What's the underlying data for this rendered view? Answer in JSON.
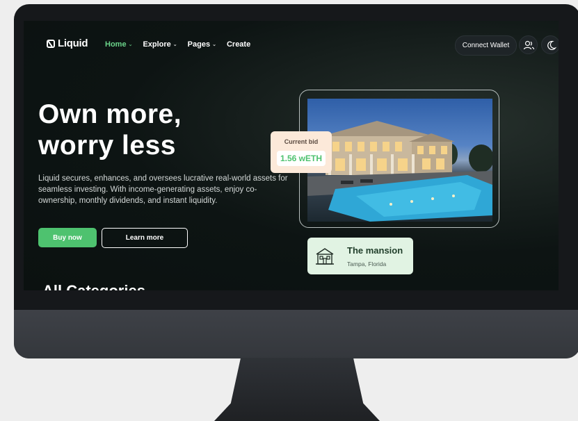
{
  "nav": {
    "logo": "Liquid",
    "menu": [
      {
        "label": "Home",
        "active": true
      },
      {
        "label": "Explore"
      },
      {
        "label": "Pages"
      },
      {
        "label": "Create"
      }
    ],
    "connect_wallet": "Connect Wallet",
    "icons": [
      "users-icon",
      "moon-icon"
    ]
  },
  "hero": {
    "title_line1": "Own more,",
    "title_line2": "worry less",
    "description": "Liquid secures, enhances, and oversees lucrative real-world assets for seamless investing. With income-generating assets, enjoy co-ownership, monthly dividends, and instant liquidity.",
    "buy_label": "Buy now",
    "learn_label": "Learn more"
  },
  "bid": {
    "label": "Current bid",
    "value": "1.56 wETH"
  },
  "property": {
    "name": "The mansion",
    "location": "Tampa, Florida"
  },
  "section": {
    "heading": "All Categories"
  },
  "colors": {
    "accent": "#4ec26f",
    "background": "#0d1413",
    "bid_card": "#fce9d9",
    "property_card": "#e1f3e3"
  }
}
